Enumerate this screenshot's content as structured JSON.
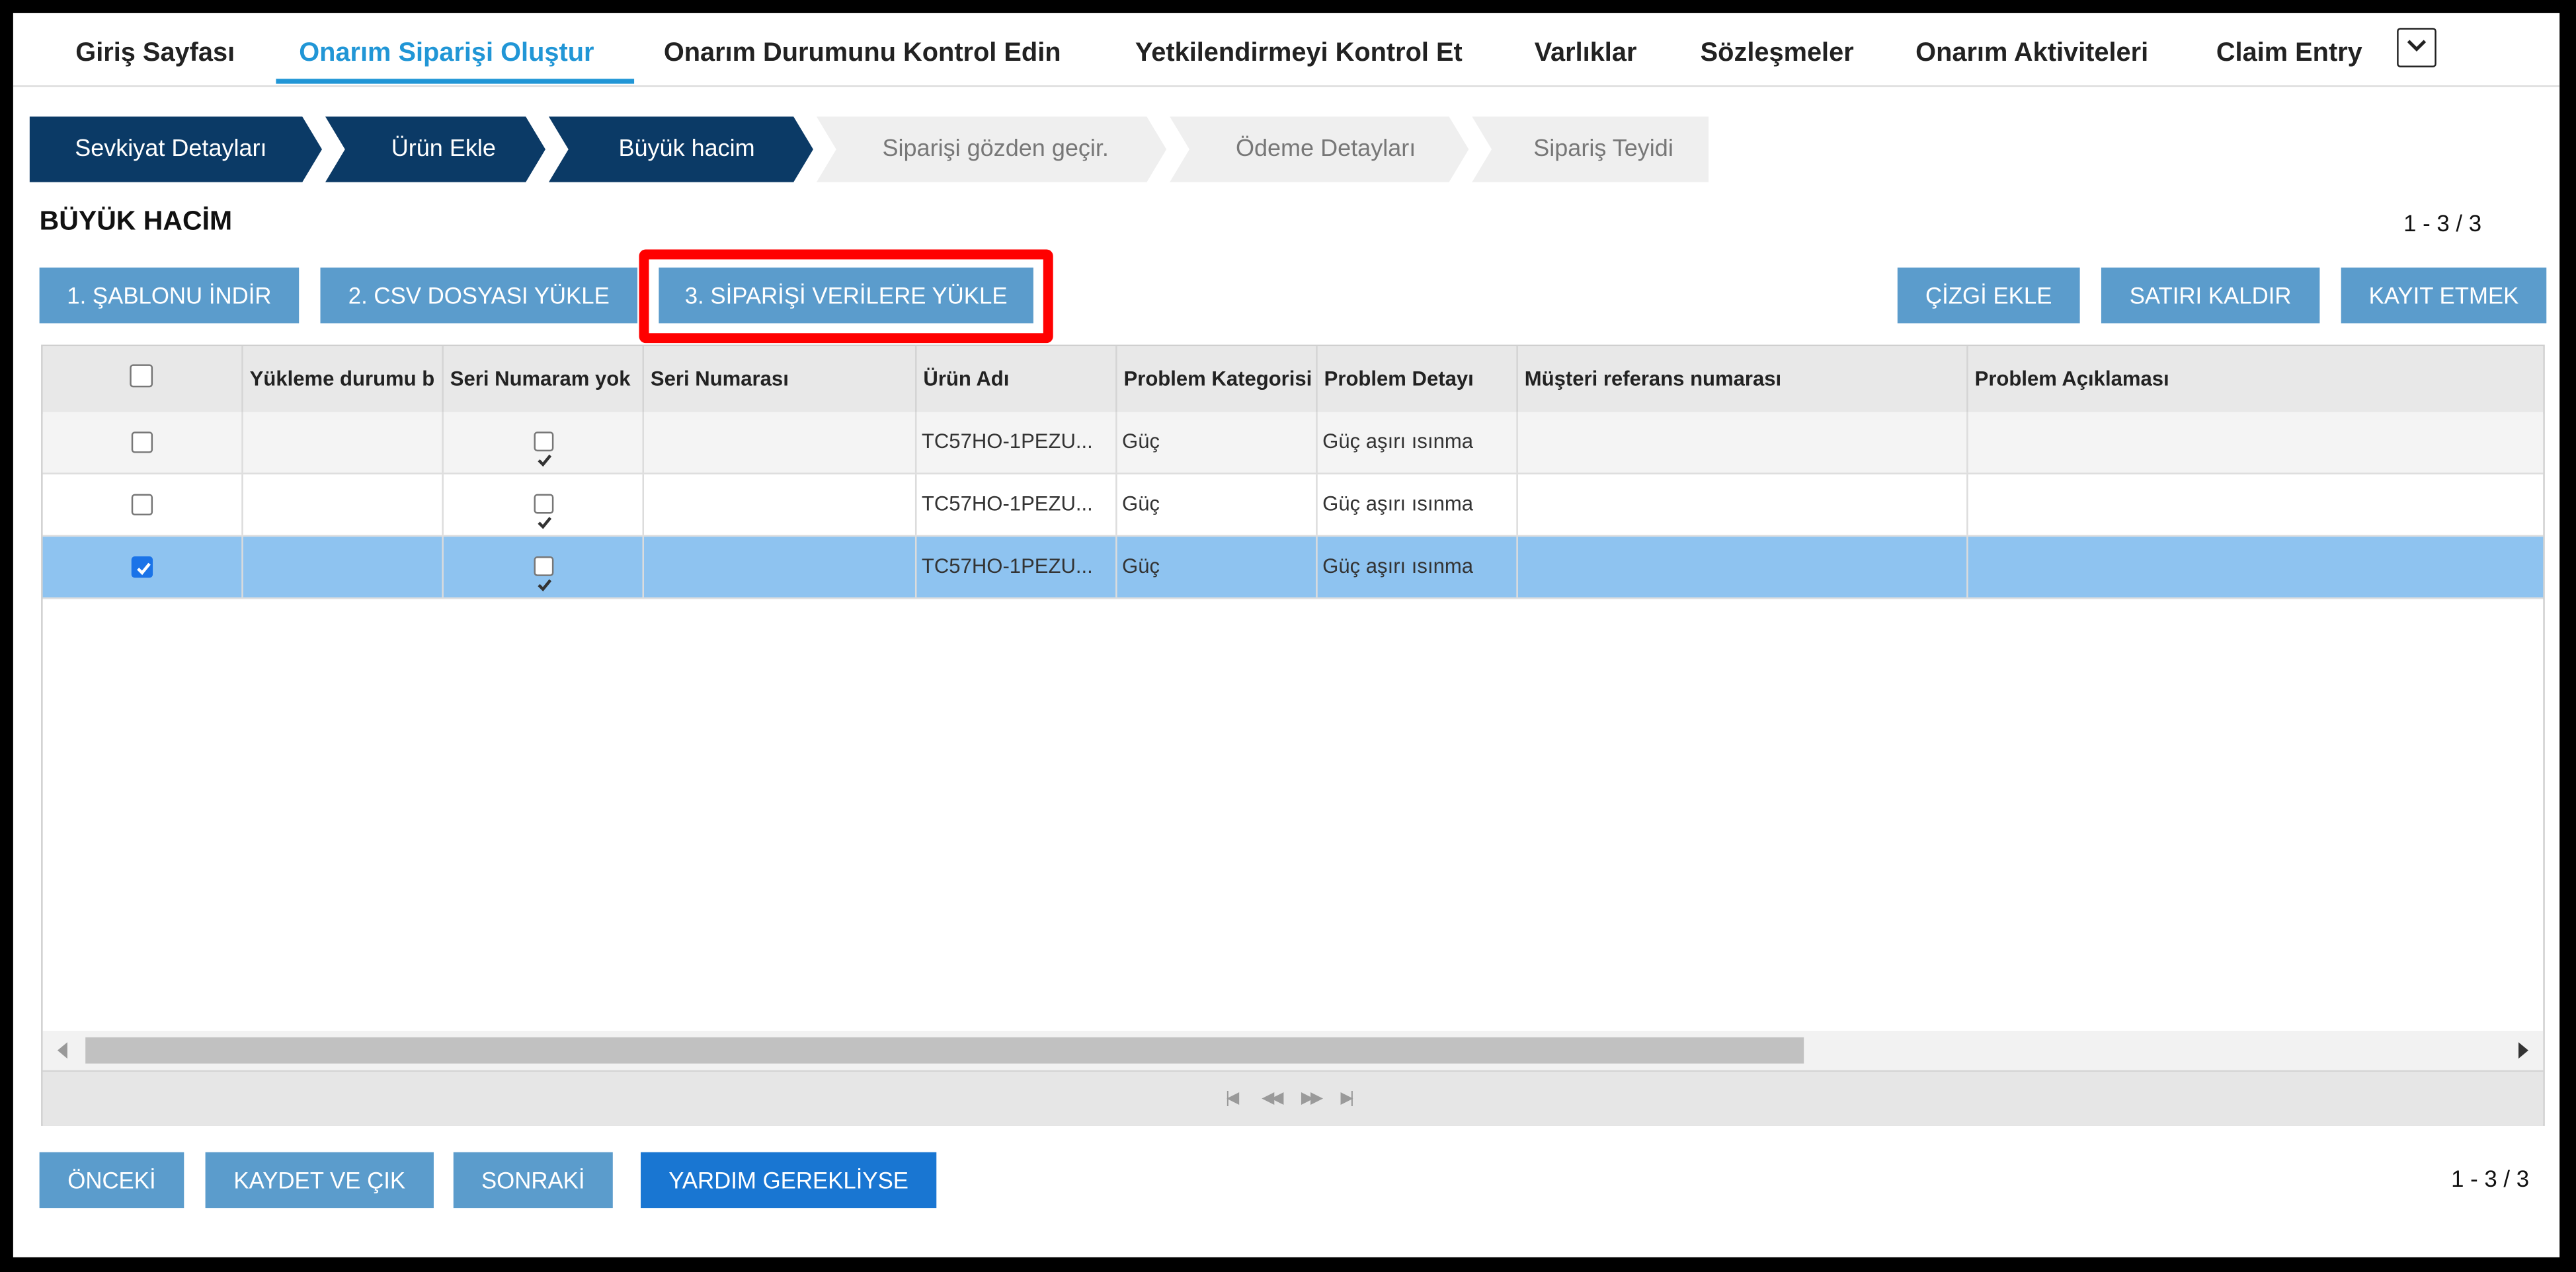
{
  "nav": {
    "items": [
      {
        "label": "Giriş Sayfası"
      },
      {
        "label": "Onarım Siparişi Oluştur"
      },
      {
        "label": "Onarım Durumunu Kontrol Edin"
      },
      {
        "label": "Yetkilendirmeyi Kontrol Et"
      },
      {
        "label": "Varlıklar"
      },
      {
        "label": "Sözleşmeler"
      },
      {
        "label": "Onarım Aktiviteleri"
      },
      {
        "label": "Claim Entry"
      }
    ],
    "active_index": 1,
    "more_icon": "chevron-down-icon"
  },
  "steps": [
    {
      "label": "Sevkiyat Detayları",
      "state": "done"
    },
    {
      "label": "Ürün Ekle",
      "state": "done"
    },
    {
      "label": "Büyük hacim",
      "state": "done"
    },
    {
      "label": "Siparişi gözden geçir.",
      "state": "todo"
    },
    {
      "label": "Ödeme Detayları",
      "state": "todo"
    },
    {
      "label": "Sipariş Teyidi",
      "state": "todo"
    }
  ],
  "section": {
    "title": "BÜYÜK HACİM",
    "page_count": "1 - 3 / 3"
  },
  "toolbar": {
    "download_template": "1. ŞABLONU İNDİR",
    "upload_csv": "2. CSV DOSYASI YÜKLE",
    "upload_order": "3. SİPARİŞİ VERİLERE YÜKLE",
    "add_line": "ÇİZGİ EKLE",
    "remove_row": "SATIRI KALDIR",
    "save": "KAYIT ETMEK"
  },
  "table": {
    "columns": [
      "Yükleme durumu b",
      "Seri Numaram yok",
      "Seri Numarası",
      "Ürün Adı",
      "Problem Kategorisi",
      "Problem Detayı",
      "Müşteri referans numarası",
      "Problem Açıklaması"
    ],
    "rows": [
      {
        "selected": false,
        "status": "",
        "no_serial": true,
        "serial": "",
        "product": "TC57HO-1PEZU...",
        "category": "Güç",
        "detail": "Güç aşırı ısınma",
        "customer_ref": "",
        "description": ""
      },
      {
        "selected": false,
        "status": "",
        "no_serial": true,
        "serial": "",
        "product": "TC57HO-1PEZU...",
        "category": "Güç",
        "detail": "Güç aşırı ısınma",
        "customer_ref": "",
        "description": ""
      },
      {
        "selected": true,
        "status": "",
        "no_serial": true,
        "serial": "",
        "product": "TC57HO-1PEZU...",
        "category": "Güç",
        "detail": "Güç aşırı ısınma",
        "customer_ref": "",
        "description": ""
      }
    ]
  },
  "footer": {
    "prev": "ÖNCEKİ",
    "save_exit": "KAYDET VE ÇIK",
    "next": "SONRAKİ",
    "help": "YARDIM GEREKLİYSE",
    "page_count": "1 - 3 / 3"
  },
  "colors": {
    "accent": "#2196d6",
    "step_done": "#0b3a66",
    "button": "#5b9ccc",
    "button_primary": "#1976d2",
    "selected_row": "#8ec3f0",
    "highlight": "#ff0000"
  }
}
